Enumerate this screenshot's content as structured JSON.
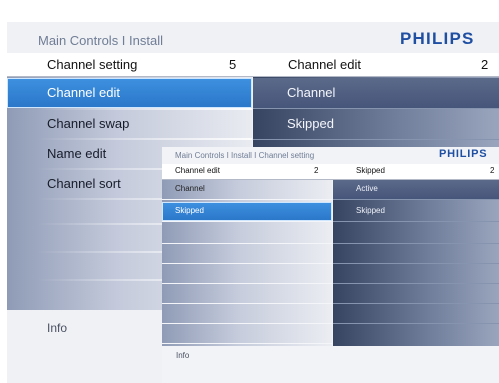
{
  "back_menu": {
    "breadcrumb": "Main Controls I Install",
    "brand": "PHILIPS",
    "header": {
      "left_label": "Channel setting",
      "left_value": "5",
      "right_label": "Channel edit",
      "right_value": "2"
    },
    "left_items": [
      {
        "label": "Channel edit",
        "selected": true
      },
      {
        "label": "Channel swap",
        "selected": false
      },
      {
        "label": "Name edit",
        "selected": false
      },
      {
        "label": "Channel sort",
        "selected": false
      }
    ],
    "right_items": [
      {
        "label": "Channel",
        "highlighted": true
      },
      {
        "label": "Skipped",
        "highlighted": false
      }
    ],
    "info": "Info"
  },
  "front_menu": {
    "breadcrumb": "Main Controls I Install I Channel setting",
    "brand": "PHILIPS",
    "header": {
      "left_label": "Channel edit",
      "left_value": "2",
      "right_label": "Skipped",
      "right_value": "2"
    },
    "left_items": [
      {
        "label": "Channel",
        "selected": false
      },
      {
        "label": "Skipped",
        "selected": true
      }
    ],
    "right_items": [
      {
        "label": "Active",
        "highlighted": true
      },
      {
        "label": "Skipped",
        "highlighted": false
      }
    ],
    "info": "Info"
  },
  "colors": {
    "brand_blue": "#1f4fa3",
    "selection_blue": "#2f80d4",
    "panel_dark": "#3a4866"
  }
}
